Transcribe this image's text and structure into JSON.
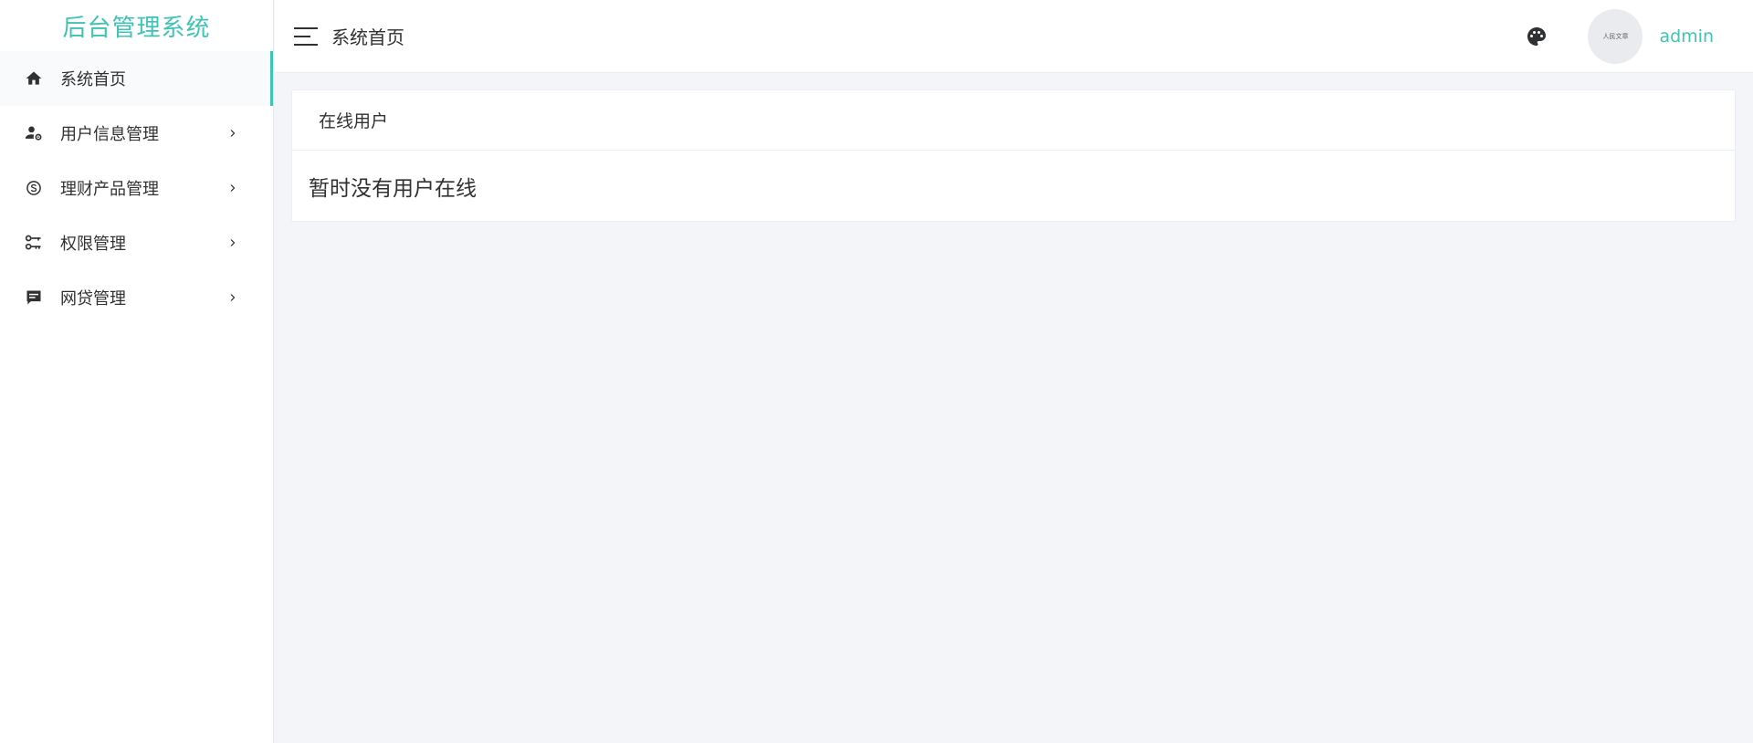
{
  "sidebar": {
    "brand": "后台管理系统",
    "items": [
      {
        "label": "系统首页",
        "icon": "home-icon",
        "active": true,
        "has_children": false
      },
      {
        "label": "用户信息管理",
        "icon": "user-settings-icon",
        "active": false,
        "has_children": true
      },
      {
        "label": "理财产品管理",
        "icon": "skype-icon",
        "active": false,
        "has_children": true
      },
      {
        "label": "权限管理",
        "icon": "key-settings-icon",
        "active": false,
        "has_children": true
      },
      {
        "label": "网贷管理",
        "icon": "message-icon",
        "active": false,
        "has_children": true
      }
    ]
  },
  "header": {
    "breadcrumb": "系统首页",
    "theme_icon": "palette-icon",
    "avatar_text": "人民文章",
    "username": "admin"
  },
  "main": {
    "card_title": "在线用户",
    "card_message": "暂时没有用户在线"
  },
  "colors": {
    "accent": "#3fc3b4",
    "background": "#f3f5f9",
    "text": "#303133"
  }
}
